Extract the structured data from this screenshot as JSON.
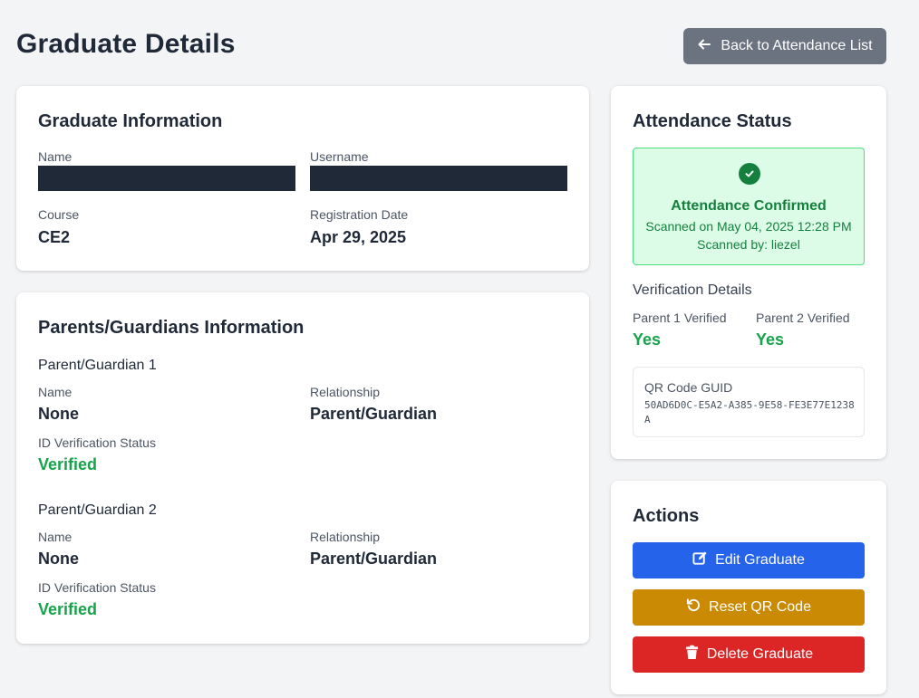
{
  "page": {
    "title": "Graduate Details",
    "back_button_label": "Back to Attendance List"
  },
  "graduate_info": {
    "heading": "Graduate Information",
    "name_label": "Name",
    "username_label": "Username",
    "course_label": "Course",
    "course_value": "CE2",
    "registration_date_label": "Registration Date",
    "registration_date_value": "Apr 29, 2025"
  },
  "parents": {
    "heading": "Parents/Guardians Information",
    "guardians": [
      {
        "title": "Parent/Guardian 1",
        "name_label": "Name",
        "name_value": "None",
        "relationship_label": "Relationship",
        "relationship_value": "Parent/Guardian",
        "id_status_label": "ID Verification Status",
        "id_status_value": "Verified"
      },
      {
        "title": "Parent/Guardian 2",
        "name_label": "Name",
        "name_value": "None",
        "relationship_label": "Relationship",
        "relationship_value": "Parent/Guardian",
        "id_status_label": "ID Verification Status",
        "id_status_value": "Verified"
      }
    ]
  },
  "attendance": {
    "heading": "Attendance Status",
    "confirmed_title": "Attendance Confirmed",
    "scanned_on": "Scanned on May 04, 2025 12:28 PM",
    "scanned_by": "Scanned by: liezel",
    "verification_heading": "Verification Details",
    "parent1_label": "Parent 1 Verified",
    "parent1_value": "Yes",
    "parent2_label": "Parent 2 Verified",
    "parent2_value": "Yes",
    "qr_label": "QR Code GUID",
    "qr_value": "50AD6D0C-E5A2-A385-9E58-FE3E77E1238A"
  },
  "actions": {
    "heading": "Actions",
    "edit_label": "Edit Graduate",
    "reset_label": "Reset QR Code",
    "delete_label": "Delete Graduate"
  },
  "colors": {
    "success": "#16a34a",
    "edit": "#2563eb",
    "reset": "#ca8a04",
    "delete": "#dc2626",
    "back": "#6b7280"
  },
  "icons": {
    "back": "arrow-left-icon",
    "confirmed": "check-circle-icon",
    "edit": "edit-icon",
    "reset": "undo-icon",
    "delete": "trash-icon"
  }
}
